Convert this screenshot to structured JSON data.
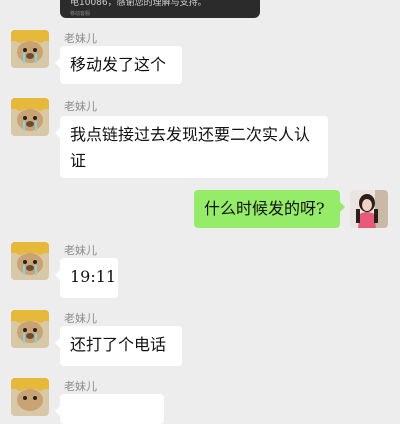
{
  "top_card": {
    "text": "电10086，感谢您的理解与支持。",
    "subtext": "移动客服"
  },
  "messages": [
    {
      "sender": "老妹儿",
      "text": "移动发了这个",
      "side": "left"
    },
    {
      "sender": "老妹儿",
      "text": "我点链接过去发现还要二次实人认证",
      "side": "left"
    },
    {
      "sender": "",
      "text": "什么时候发的呀?",
      "side": "right"
    },
    {
      "sender": "老妹儿",
      "text": "19:11",
      "side": "left"
    },
    {
      "sender": "老妹儿",
      "text": "还打了个电话",
      "side": "left"
    },
    {
      "sender": "老妹儿",
      "text": "",
      "side": "left"
    }
  ],
  "colors": {
    "background": "#ededed",
    "left_bubble": "#ffffff",
    "right_bubble": "#95ec69",
    "sender_name": "#8a8a8a"
  }
}
